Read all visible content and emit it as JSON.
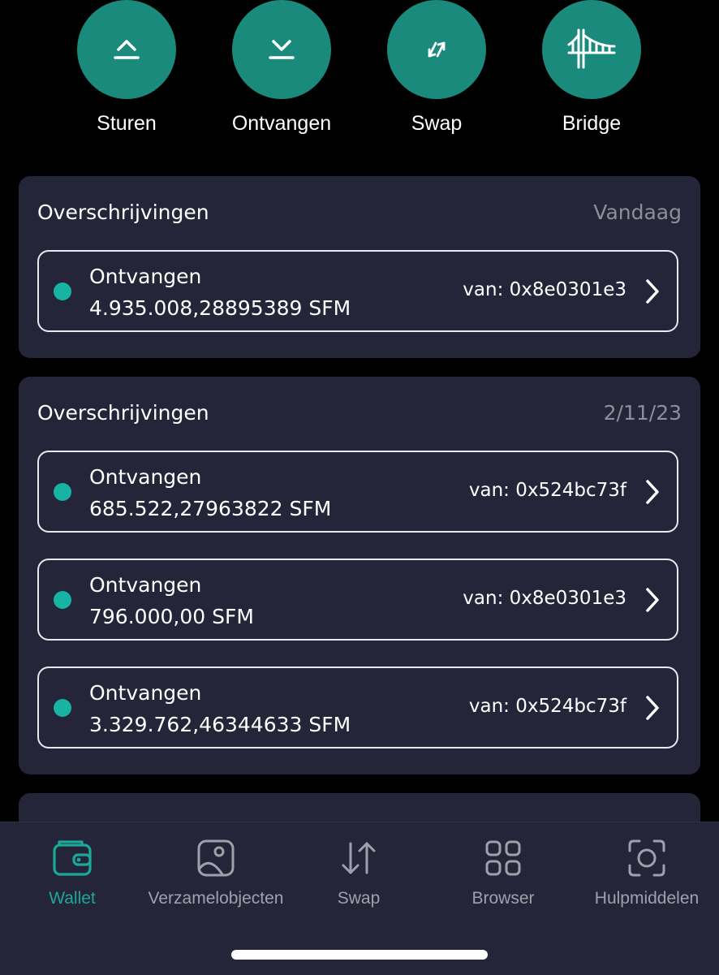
{
  "actions": [
    {
      "label": "Sturen",
      "icon": "send-icon"
    },
    {
      "label": "Ontvangen",
      "icon": "receive-icon"
    },
    {
      "label": "Swap",
      "icon": "swap-icon"
    },
    {
      "label": "Bridge",
      "icon": "bridge-icon"
    }
  ],
  "colors": {
    "accent": "#1a8a7c",
    "accent_active": "#1aa898",
    "dot": "#17b3a3",
    "card": "#25253a",
    "background": "#000000"
  },
  "groups": [
    {
      "title": "Overschrijvingen",
      "date": "Vandaag",
      "items": [
        {
          "type": "Ontvangen",
          "amount": "4.935.008,28895389 SFM",
          "from": "van: 0x8e0301e3"
        }
      ]
    },
    {
      "title": "Overschrijvingen",
      "date": "2/11/23",
      "items": [
        {
          "type": "Ontvangen",
          "amount": "685.522,27963822 SFM",
          "from": "van: 0x524bc73f"
        },
        {
          "type": "Ontvangen",
          "amount": "796.000,00 SFM",
          "from": "van: 0x8e0301e3"
        },
        {
          "type": "Ontvangen",
          "amount": "3.329.762,46344633 SFM",
          "from": "van: 0x524bc73f"
        }
      ]
    }
  ],
  "nav": [
    {
      "label": "Wallet",
      "icon": "wallet-icon",
      "active": true
    },
    {
      "label": "Verzamelobjecten",
      "icon": "collectibles-icon",
      "active": false
    },
    {
      "label": "Swap",
      "icon": "swap-arrows-icon",
      "active": false
    },
    {
      "label": "Browser",
      "icon": "browser-grid-icon",
      "active": false
    },
    {
      "label": "Hulpmiddelen",
      "icon": "tools-scan-icon",
      "active": false
    }
  ]
}
